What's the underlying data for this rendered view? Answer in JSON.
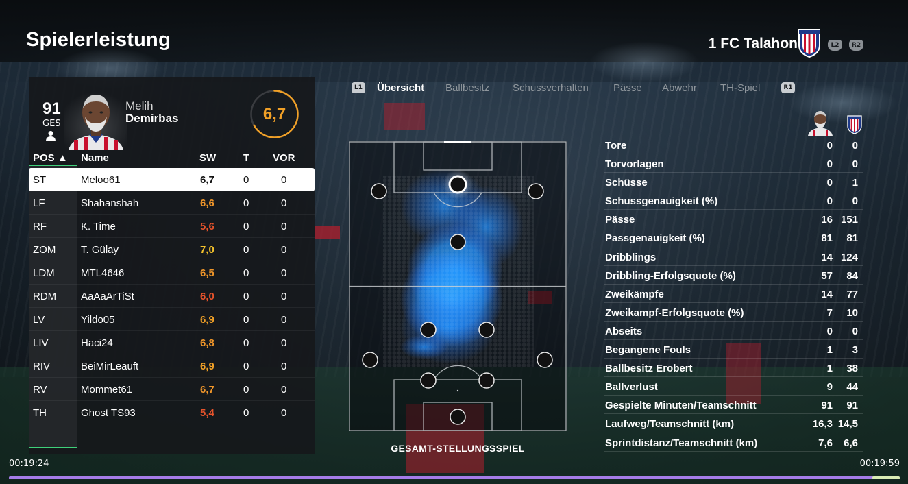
{
  "header": {
    "title": "Spielerleistung",
    "club_name": "1 FC Talahon",
    "hint_left": "L2",
    "hint_right": "R2"
  },
  "player": {
    "overall": "91",
    "overall_label": "GES",
    "first_name": "Melih",
    "last_name": "Demirbas",
    "rating": "6,7",
    "rating_fraction": 0.67
  },
  "table": {
    "headers": {
      "pos": "POS ▲",
      "name": "Name",
      "sw": "SW",
      "t": "T",
      "vor": "VOR"
    },
    "rows": [
      {
        "pos": "ST",
        "name": "Meloo61",
        "sw": "6,7",
        "t": "0",
        "vor": "0",
        "color": "#111111"
      },
      {
        "pos": "LF",
        "name": "Shahanshah",
        "sw": "6,6",
        "t": "0",
        "vor": "0",
        "color": "#f0962a"
      },
      {
        "pos": "RF",
        "name": "K. Time",
        "sw": "5,6",
        "t": "0",
        "vor": "0",
        "color": "#e5532b"
      },
      {
        "pos": "ZOM",
        "name": "T. Gülay",
        "sw": "7,0",
        "t": "0",
        "vor": "0",
        "color": "#f3c12c"
      },
      {
        "pos": "LDM",
        "name": "MTL4646",
        "sw": "6,5",
        "t": "0",
        "vor": "0",
        "color": "#f0962a"
      },
      {
        "pos": "RDM",
        "name": "AaAaArTiSt",
        "sw": "6,0",
        "t": "0",
        "vor": "0",
        "color": "#e5532b"
      },
      {
        "pos": "LV",
        "name": "Yildo05",
        "sw": "6,9",
        "t": "0",
        "vor": "0",
        "color": "#f0a027"
      },
      {
        "pos": "LIV",
        "name": "Haci24",
        "sw": "6,8",
        "t": "0",
        "vor": "0",
        "color": "#f0962a"
      },
      {
        "pos": "RIV",
        "name": "BeiMirLeauft",
        "sw": "6,9",
        "t": "0",
        "vor": "0",
        "color": "#f0a027"
      },
      {
        "pos": "RV",
        "name": "Mommet61",
        "sw": "6,7",
        "t": "0",
        "vor": "0",
        "color": "#f0962a"
      },
      {
        "pos": "TH",
        "name": "Ghost TS93",
        "sw": "5,4",
        "t": "0",
        "vor": "0",
        "color": "#e5532b"
      }
    ]
  },
  "tabs": {
    "hint_left": "L1",
    "hint_right": "R1",
    "items": [
      "Übersicht",
      "Ballbesitz",
      "Schussverhalten",
      "Pässe",
      "Abwehr",
      "TH-Spiel"
    ],
    "active": 0
  },
  "pitch": {
    "caption": "GESAMT-STELLUNGSSPIEL"
  },
  "stats": [
    {
      "label": "Tore",
      "player": "0",
      "team": "0"
    },
    {
      "label": "Torvorlagen",
      "player": "0",
      "team": "0"
    },
    {
      "label": "Schüsse",
      "player": "0",
      "team": "1"
    },
    {
      "label": "Schussgenauigkeit (%)",
      "player": "0",
      "team": "0"
    },
    {
      "label": "Pässe",
      "player": "16",
      "team": "151"
    },
    {
      "label": "Passgenauigkeit (%)",
      "player": "81",
      "team": "81"
    },
    {
      "label": "Dribblings",
      "player": "14",
      "team": "124"
    },
    {
      "label": "Dribbling-Erfolgsquote (%)",
      "player": "57",
      "team": "84"
    },
    {
      "label": "Zweikämpfe",
      "player": "14",
      "team": "77"
    },
    {
      "label": "Zweikampf-Erfolgsquote (%)",
      "player": "7",
      "team": "10"
    },
    {
      "label": "Abseits",
      "player": "0",
      "team": "0"
    },
    {
      "label": "Begangene Fouls",
      "player": "1",
      "team": "3"
    },
    {
      "label": "Ballbesitz Erobert",
      "player": "1",
      "team": "38"
    },
    {
      "label": "Ballverlust",
      "player": "9",
      "team": "44"
    },
    {
      "label": "Gespielte Minuten/Teamschnitt",
      "player": "91",
      "team": "91"
    },
    {
      "label": "Laufweg/Teamschnitt (km)",
      "player": "16,3",
      "team": "14,5"
    },
    {
      "label": "Sprintdistanz/Teamschnitt (km)",
      "player": "7,6",
      "team": "6,6"
    }
  ],
  "video": {
    "current_time": "00:19:24",
    "total_time": "00:19:59",
    "progress_fraction": 0.971
  },
  "colors": {
    "accent_orange": "#f0a027",
    "heat_blue": "#1e90ff",
    "progress_purple": "#a57ce8",
    "crest_red": "#c8102e"
  }
}
